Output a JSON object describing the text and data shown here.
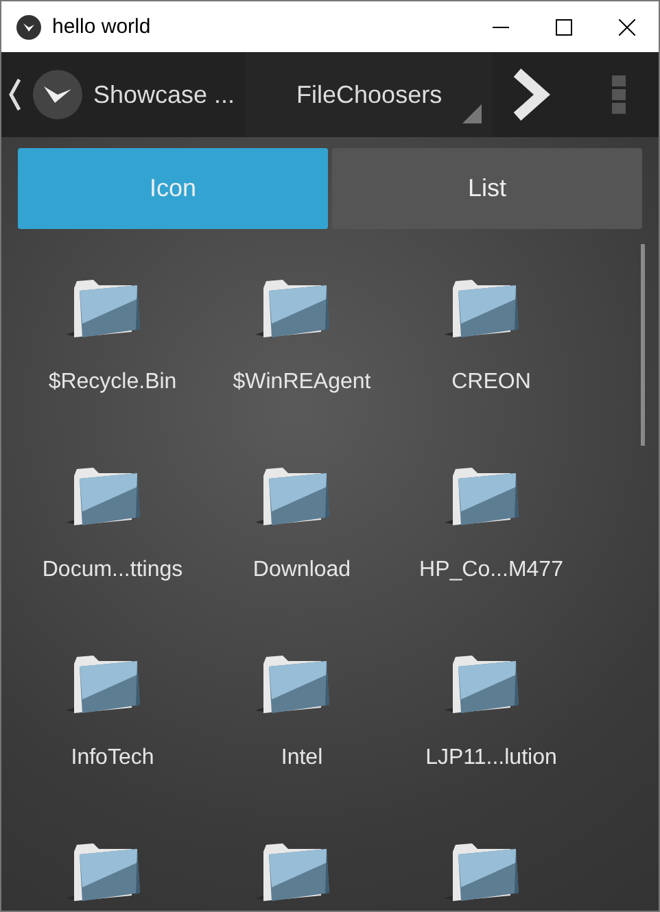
{
  "window": {
    "title": "hello world"
  },
  "action_bar": {
    "title": "Showcase ...",
    "spinner": {
      "value": "FileChoosers"
    }
  },
  "tabs": [
    {
      "label": "Icon",
      "selected": true
    },
    {
      "label": "List",
      "selected": false
    }
  ],
  "files": [
    {
      "kind": "folder",
      "name": "$Recycle.Bin"
    },
    {
      "kind": "folder",
      "name": "$WinREAgent"
    },
    {
      "kind": "folder",
      "name": "CREON"
    },
    {
      "kind": "folder",
      "name": "Docum...ttings"
    },
    {
      "kind": "folder",
      "name": "Download"
    },
    {
      "kind": "folder",
      "name": "HP_Co...M477"
    },
    {
      "kind": "folder",
      "name": "InfoTech"
    },
    {
      "kind": "folder",
      "name": "Intel"
    },
    {
      "kind": "folder",
      "name": "LJP11...lution"
    },
    {
      "kind": "folder"
    },
    {
      "kind": "folder"
    },
    {
      "kind": "folder"
    }
  ]
}
